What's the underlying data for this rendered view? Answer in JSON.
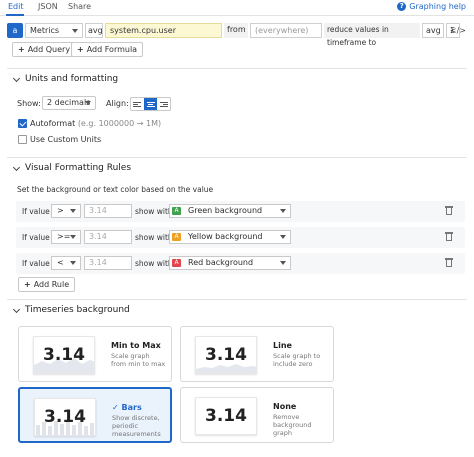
{
  "tabs": [
    {
      "label": "Edit",
      "active": true
    },
    {
      "label": "JSON",
      "active": false
    },
    {
      "label": "Share",
      "active": false
    }
  ],
  "graphing_help": "Graphing help",
  "query": {
    "badge": "a",
    "source": "Metrics",
    "aggregator": "avg",
    "metric": "system.cpu.user",
    "from_label": "from",
    "scope_placeholder": "(everywhere)",
    "reduce_label": "reduce values in timeframe to",
    "reduce_value": "avg",
    "sigma": "Σ",
    "code_icon": "</>"
  },
  "buttons": {
    "add_query": "Add Query",
    "add_formula": "Add Formula",
    "add_rule": "Add Rule"
  },
  "units": {
    "title": "Units and formatting",
    "show_label": "Show:",
    "show_value": "2 decimals",
    "align_label": "Align:",
    "align_selected": "center",
    "autoformat_label": "Autoformat",
    "autoformat_hint": "(e.g. 1000000 → 1M)",
    "autoformat_checked": true,
    "custom_units_label": "Use Custom Units",
    "custom_units_checked": false
  },
  "rules": {
    "title": "Visual Formatting Rules",
    "description": "Set the background or text color based on the value",
    "if_label": "If value is",
    "show_with_label": "show with",
    "items": [
      {
        "operator": ">",
        "placeholder": "3.14",
        "badge": "A",
        "color": "#3fa34d",
        "palette": "Green background"
      },
      {
        "operator": ">=",
        "placeholder": "3.14",
        "badge": "A",
        "color": "#f0a020",
        "palette": "Yellow background"
      },
      {
        "operator": "<",
        "placeholder": "3.14",
        "badge": "A",
        "color": "#e0464e",
        "palette": "Red background"
      }
    ]
  },
  "timeseries": {
    "title": "Timeseries background",
    "accent": "#1f67c9",
    "options": [
      {
        "preview_value": "3.14",
        "title": "Min to Max",
        "description": "Scale graph from min to max",
        "selected": false,
        "style": "area"
      },
      {
        "preview_value": "3.14",
        "title": "Line",
        "description": "Scale graph to include zero",
        "selected": false,
        "style": "line"
      },
      {
        "preview_value": "3.14",
        "title": "Bars",
        "description": "Show discrete, periodic measurements",
        "selected": true,
        "style": "bars"
      },
      {
        "preview_value": "3.14",
        "title": "None",
        "description": "Remove background graph",
        "selected": false,
        "style": "none"
      }
    ]
  }
}
